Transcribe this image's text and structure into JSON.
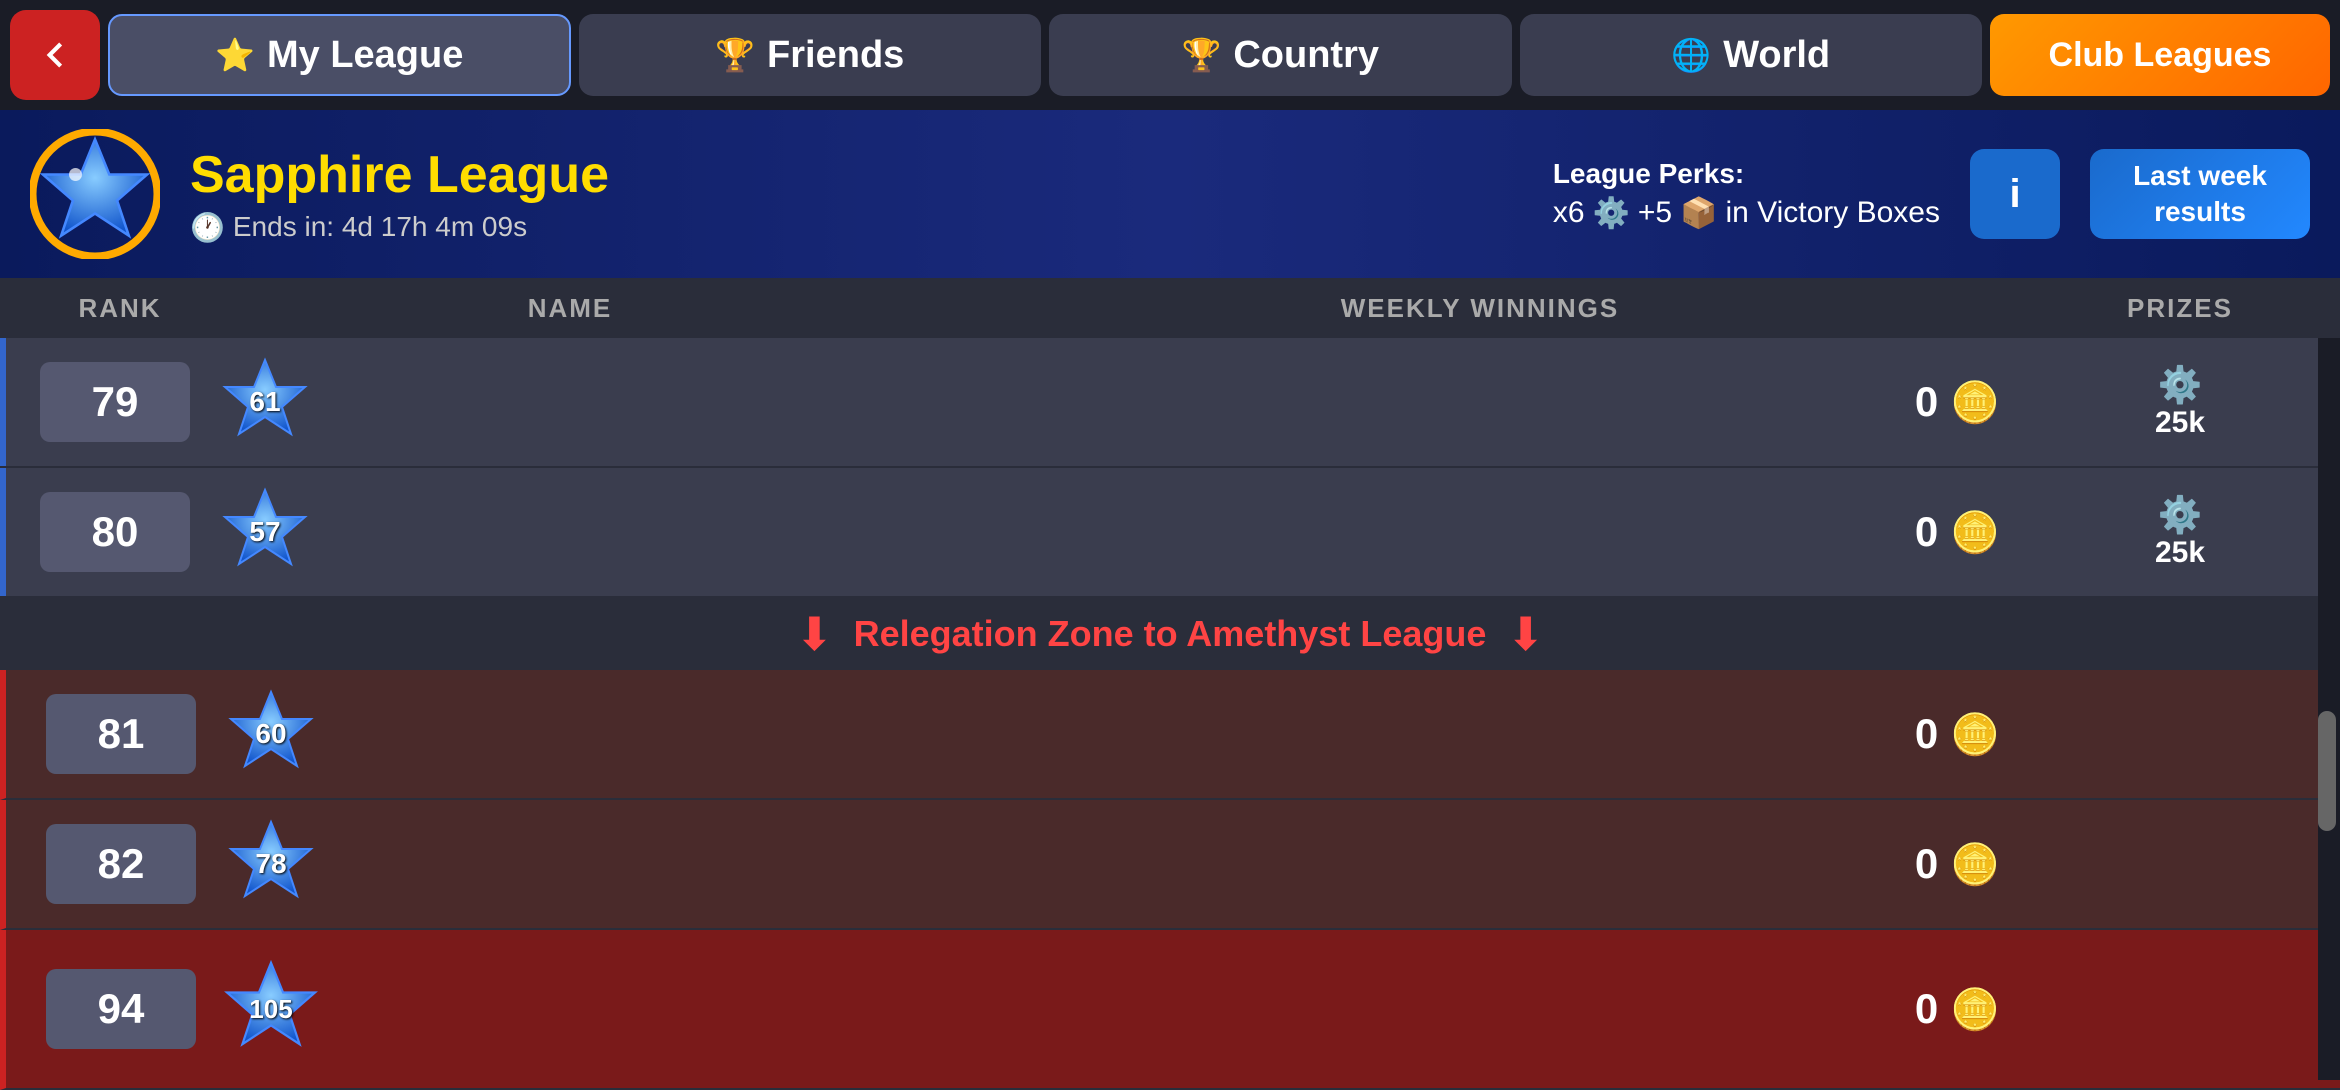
{
  "nav": {
    "back_label": "←",
    "tabs": [
      {
        "id": "my-league",
        "label": "My League",
        "icon": "⭐",
        "active": true
      },
      {
        "id": "friends",
        "label": "Friends",
        "icon": "🏆"
      },
      {
        "id": "country",
        "label": "Country",
        "icon": "🏆"
      },
      {
        "id": "world",
        "label": "World",
        "icon": "🌐"
      }
    ],
    "club_leagues_label": "Club Leagues"
  },
  "league_header": {
    "name": "Sapphire League",
    "ends_label": "Ends in: 4d 17h 4m 09s",
    "perks_title": "League Perks:",
    "perks_detail": "x6 ⚙ +5 📦 in Victory Boxes",
    "info_label": "i",
    "last_week_label": "Last week\nresults"
  },
  "table": {
    "headers": {
      "rank": "RANK",
      "name": "NAME",
      "weekly_winnings": "WEEKLY WINNINGS",
      "prizes": "PRIZES"
    },
    "rows": [
      {
        "rank": 79,
        "star_level": 61,
        "winnings": 0,
        "prize": "25k",
        "has_prize": true,
        "type": "normal"
      },
      {
        "rank": 80,
        "star_level": 57,
        "winnings": 0,
        "prize": "25k",
        "has_prize": true,
        "type": "normal"
      },
      {
        "type": "divider",
        "text": "Relegation Zone to Amethyst League"
      },
      {
        "rank": 81,
        "star_level": 60,
        "winnings": 0,
        "prize": "",
        "has_prize": false,
        "type": "relegation"
      },
      {
        "rank": 82,
        "star_level": 78,
        "winnings": 0,
        "prize": "",
        "has_prize": false,
        "type": "relegation"
      },
      {
        "rank": 94,
        "star_level": 105,
        "winnings": 0,
        "prize": "",
        "has_prize": false,
        "type": "current_player"
      }
    ]
  },
  "colors": {
    "accent_blue": "#3366cc",
    "relegation_red": "#ff4444",
    "current_player_bg": "#7a1a1a",
    "relegation_bg": "#4a2a2a"
  }
}
